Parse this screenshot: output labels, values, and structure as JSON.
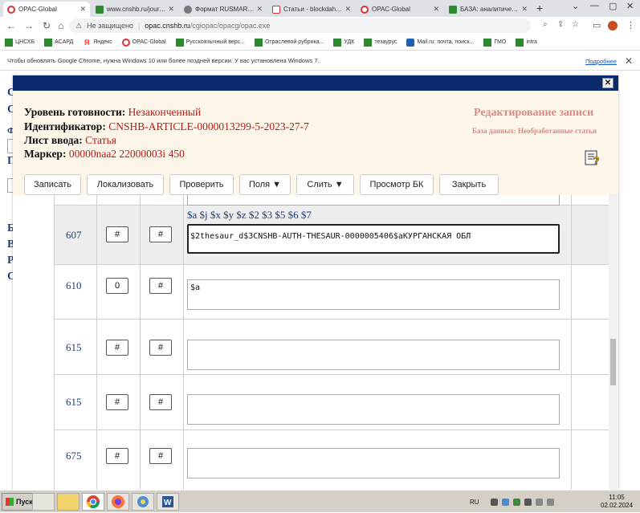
{
  "browser": {
    "tabs": [
      {
        "title": "OPAC-Global",
        "favicon": "opac-icon",
        "active": true
      },
      {
        "title": "www.cnshb.ru/jour/u...",
        "favicon": "site-icon",
        "active": false
      },
      {
        "title": "Формат RUSMARC пр...",
        "favicon": "globe-icon",
        "active": false
      },
      {
        "title": "Статьи - blockdahlia...",
        "favicon": "gmail-icon",
        "active": false
      },
      {
        "title": "OPAC-Global",
        "favicon": "opac-icon",
        "active": false
      },
      {
        "title": "БАЗА: аналитическо...",
        "favicon": "site-icon",
        "active": false
      }
    ],
    "new_tab": "+",
    "address": {
      "security": "Не защищено",
      "host": "opac.cnshb.ru",
      "path": "/cgiopac/opacg/opac.exe"
    },
    "bookmarks": [
      {
        "label": "ЦНСХБ",
        "icon": "site-icon"
      },
      {
        "label": "АСАРД",
        "icon": "site-icon"
      },
      {
        "label": "Яндекс",
        "icon": "yandex-icon"
      },
      {
        "label": "OPAC-Global",
        "icon": "opac-icon"
      },
      {
        "label": "Русскоязычный верс...",
        "icon": "site-icon"
      },
      {
        "label": "Отраслевой рубрика...",
        "icon": "site-icon"
      },
      {
        "label": "УДК",
        "icon": "site-icon"
      },
      {
        "label": "тезаурус",
        "icon": "site-icon"
      },
      {
        "label": "Mail.ru: почта, поиск...",
        "icon": "mail-icon"
      },
      {
        "label": "ГМО",
        "icon": "site-icon"
      },
      {
        "label": "intra",
        "icon": "site-icon"
      }
    ],
    "infobar": {
      "message": "Чтобы обновлять Google Chrome, нужна Windows 10 или более поздней версии. У вас установлена Windows 7.",
      "more": "Подробнее"
    }
  },
  "page_behind": {
    "letters": [
      "С",
      "С",
      "Ф",
      "П",
      "Б",
      "В",
      "Р",
      "С"
    ]
  },
  "record": {
    "status_label": "Уровень готовности:",
    "status_value": "Незаконченный",
    "id_label": "Идентификатор:",
    "id_value": "CNSHB-ARTICLE-0000013299-5-2023-27-7",
    "sheet_label": "Лист ввода:",
    "sheet_value": "Статья",
    "marker_label": "Маркер:",
    "marker_value": "00000naa2 22000003i 450",
    "edit_title": "Редактирование записи",
    "db_name": "База данных: Необработанные статьи",
    "buttons": {
      "save": "Записать",
      "localize": "Локализовать",
      "check": "Проверить",
      "fields": "Поля ▼",
      "merge": "Слить ▼",
      "view_bk": "Просмотр БК",
      "close": "Закрыть"
    },
    "rows": [
      {
        "tag": "607",
        "ind1": "#",
        "ind2": "#",
        "subfields": "$a $j $x $y $z $2 $3 $5 $6 $7",
        "value": "$2thesaur_d$3CNSHB-AUTH-THESAUR-0000005406$aКУРГАНСКАЯ ОБЛ"
      },
      {
        "tag": "610",
        "ind1": "0",
        "ind2": "#",
        "subfields": "",
        "value": "$a"
      },
      {
        "tag": "615",
        "ind1": "#",
        "ind2": "#",
        "subfields": "",
        "value": ""
      },
      {
        "tag": "615",
        "ind1": "#",
        "ind2": "#",
        "subfields": "",
        "value": ""
      },
      {
        "tag": "675",
        "ind1": "#",
        "ind2": "#",
        "subfields": "",
        "value": ""
      }
    ]
  },
  "taskbar": {
    "start": "Пуск",
    "lang": "RU",
    "time": "11:05",
    "date": "02.02.2024"
  }
}
